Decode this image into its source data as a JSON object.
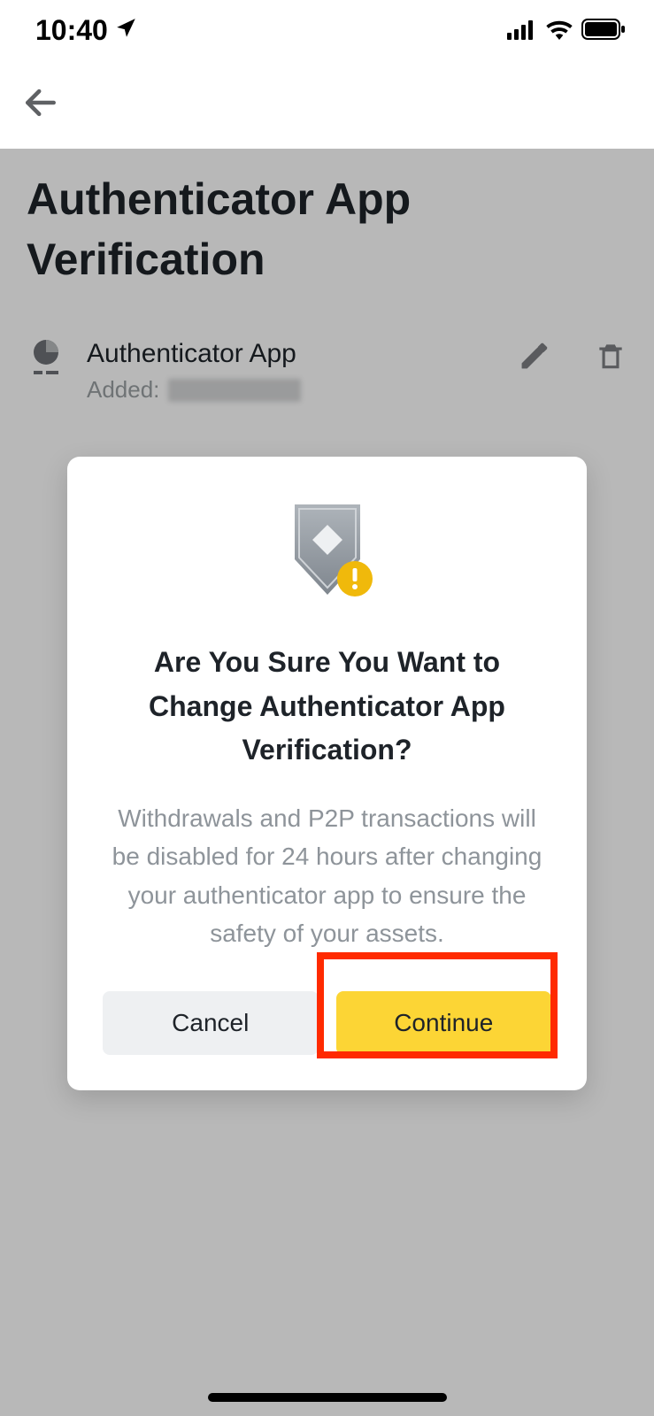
{
  "status": {
    "time": "10:40"
  },
  "page": {
    "title": "Authenticator App Verification",
    "item_name": "Authenticator App",
    "added_label": "Added:"
  },
  "modal": {
    "title": "Are You Sure You Want to Change Authenticator App Verification?",
    "body": "Withdrawals and P2P transactions will be disabled for 24 hours after changing your authenticator app to ensure the safety of your assets.",
    "cancel": "Cancel",
    "continue": "Continue"
  }
}
